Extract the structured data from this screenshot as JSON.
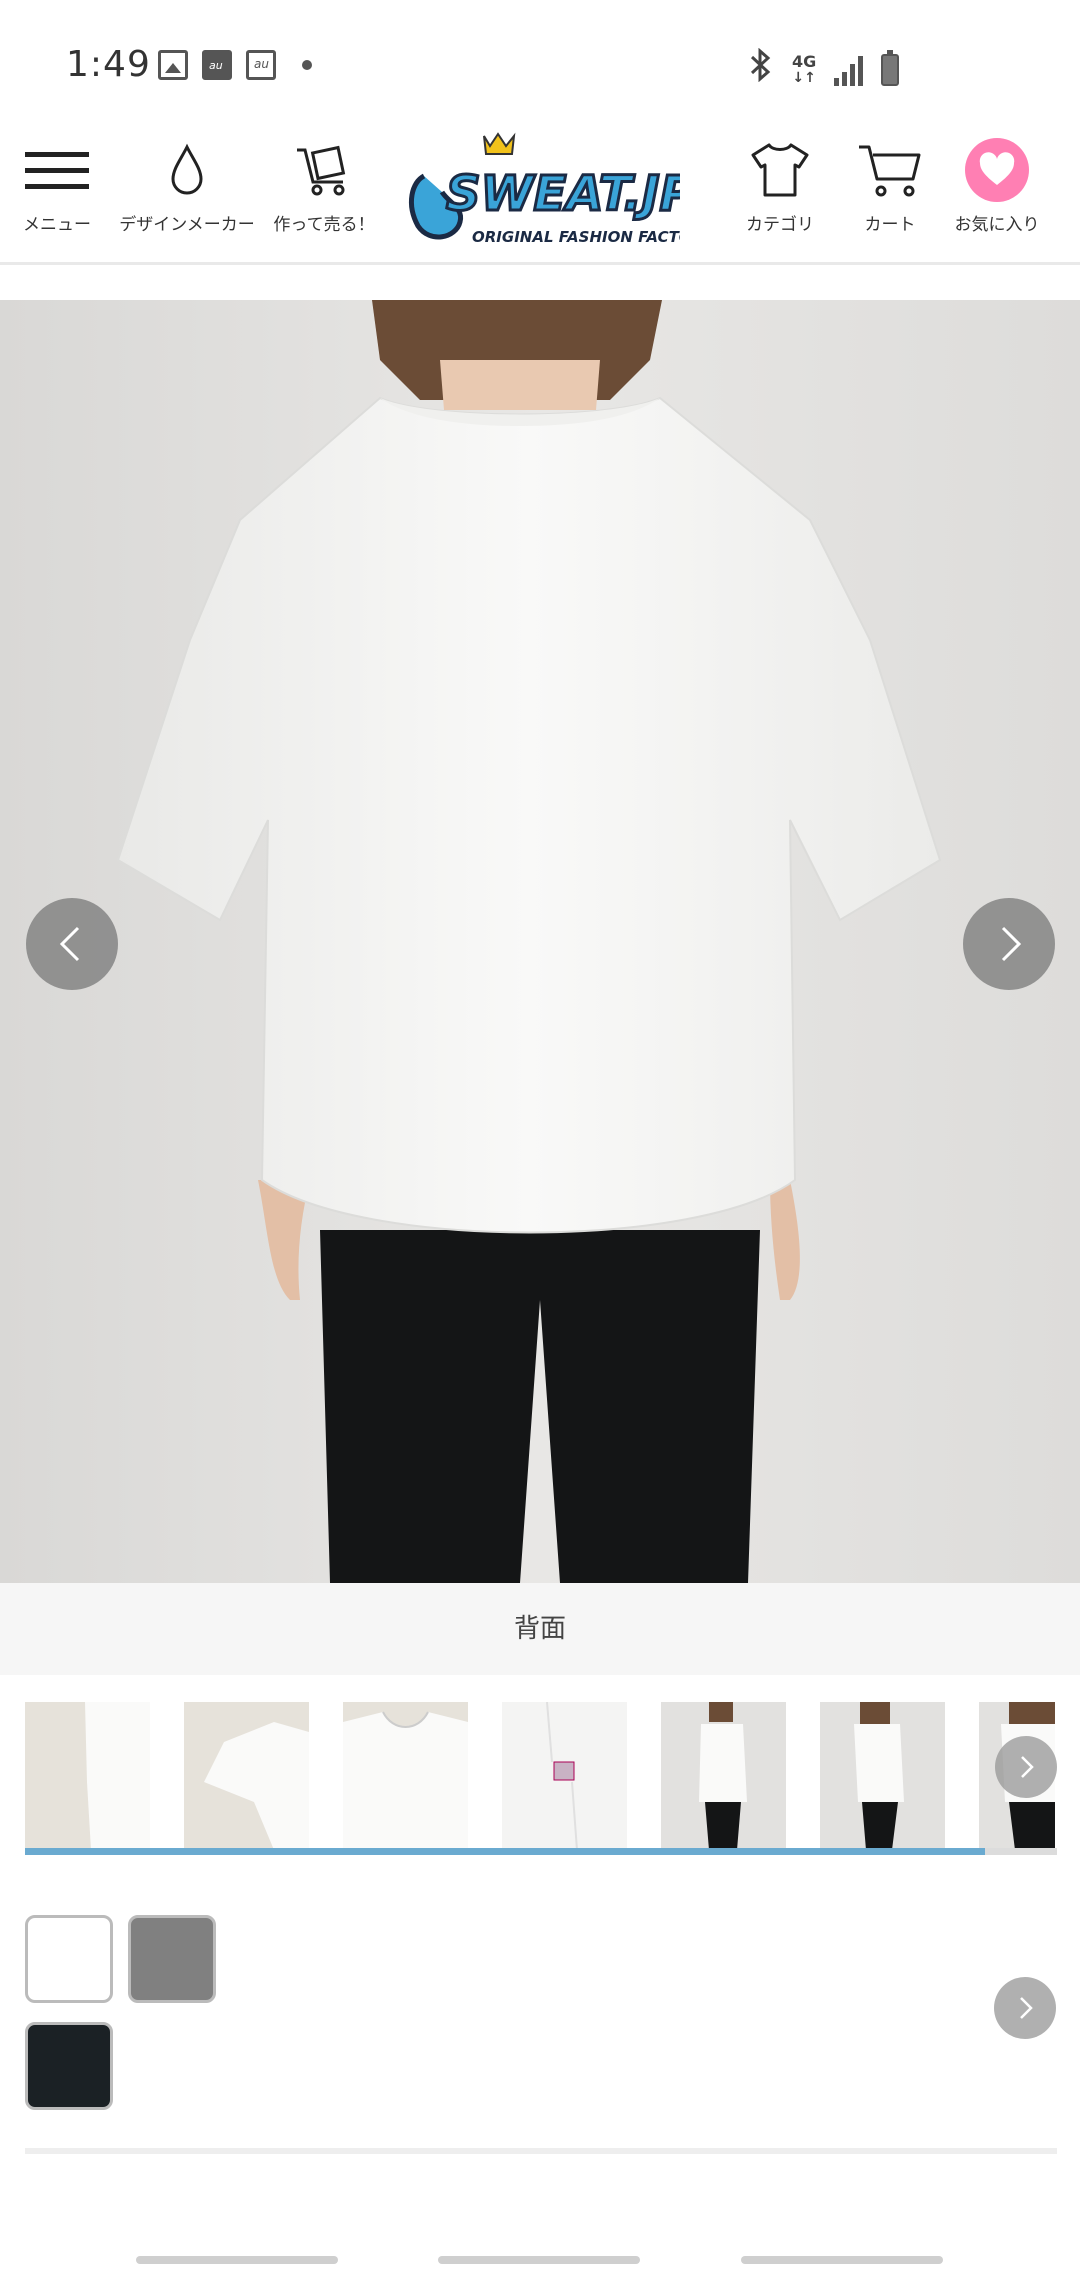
{
  "status_bar": {
    "time": "1:49",
    "network": "4G"
  },
  "header": {
    "nav_left": [
      {
        "label": "メニュー",
        "icon": "menu-icon"
      },
      {
        "label": "デザインメーカー",
        "icon": "drop-icon"
      },
      {
        "label": "作って売る！",
        "icon": "cart-box-icon"
      }
    ],
    "logo_text": "SWEAT.JP",
    "logo_tagline": "ORIGINAL FASHION FACTORY",
    "nav_right": [
      {
        "label": "カテゴリ",
        "icon": "tshirt-icon"
      },
      {
        "label": "カート",
        "icon": "cart-icon"
      },
      {
        "label": "お気に入り",
        "icon": "heart-icon"
      }
    ],
    "accent_pink": "#ff7fb3",
    "logo_blue": "#3aa4d8"
  },
  "product_image": {
    "caption": "背面",
    "description_icon": "tshirt-back-photo"
  },
  "thumbnails": [
    {
      "name": "folded-shirt-detail"
    },
    {
      "name": "shirt-sleeve-flat"
    },
    {
      "name": "shirt-front-flat"
    },
    {
      "name": "shirt-tag-detail"
    },
    {
      "name": "model-side-view"
    },
    {
      "name": "model-side-view-2"
    },
    {
      "name": "model-back-partial"
    }
  ],
  "colors": [
    {
      "name": "white",
      "hex": "#ffffff"
    },
    {
      "name": "gray",
      "hex": "#808080"
    },
    {
      "name": "black",
      "hex": "#1b2125"
    }
  ],
  "thumb_scroll_progress": 0.93
}
